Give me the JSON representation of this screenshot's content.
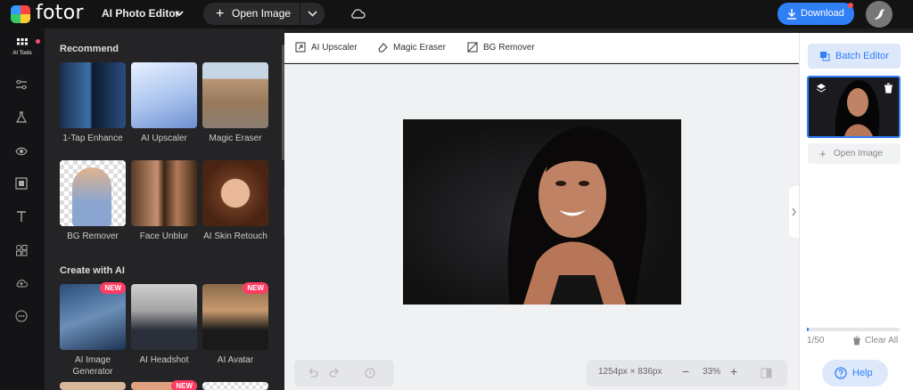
{
  "header": {
    "logo_text": "fotor",
    "editor_menu": "AI Photo Editor",
    "open_image": "Open Image",
    "download": "Download"
  },
  "iconbar": {
    "items": [
      {
        "icon": "grid-icon",
        "label": "AI Tools"
      },
      {
        "icon": "sliders-icon"
      },
      {
        "icon": "flask-icon"
      },
      {
        "icon": "eye-icon"
      },
      {
        "icon": "frame-icon"
      },
      {
        "icon": "text-icon"
      },
      {
        "icon": "elements-icon"
      },
      {
        "icon": "cloud-upload-icon"
      },
      {
        "icon": "more-icon"
      }
    ]
  },
  "panel": {
    "recommend_title": "Recommend",
    "recommend": [
      {
        "label": "1-Tap Enhance"
      },
      {
        "label": "AI Upscaler"
      },
      {
        "label": "Magic Eraser"
      },
      {
        "label": "BG Remover"
      },
      {
        "label": "Face Unblur"
      },
      {
        "label": "AI Skin Retouch"
      }
    ],
    "create_title": "Create with AI",
    "create": [
      {
        "label": "AI Image Generator",
        "badge": "NEW"
      },
      {
        "label": "AI Headshot",
        "badge": ""
      },
      {
        "label": "AI Avatar",
        "badge": "NEW"
      }
    ],
    "extra_badge": "NEW"
  },
  "toolbar": {
    "upscaler": "AI Upscaler",
    "eraser": "Magic Eraser",
    "bg_remover": "BG Remover"
  },
  "bottom": {
    "dimensions": "1254px × 836px",
    "zoom": "33%"
  },
  "right": {
    "batch_editor": "Batch Editor",
    "open_image": "Open Image",
    "count": "1/50",
    "progress": 0.02,
    "clear_all": "Clear All",
    "help": "Help"
  },
  "colors": {
    "accent": "#2f7ff7",
    "badge": "#ff3b63"
  }
}
